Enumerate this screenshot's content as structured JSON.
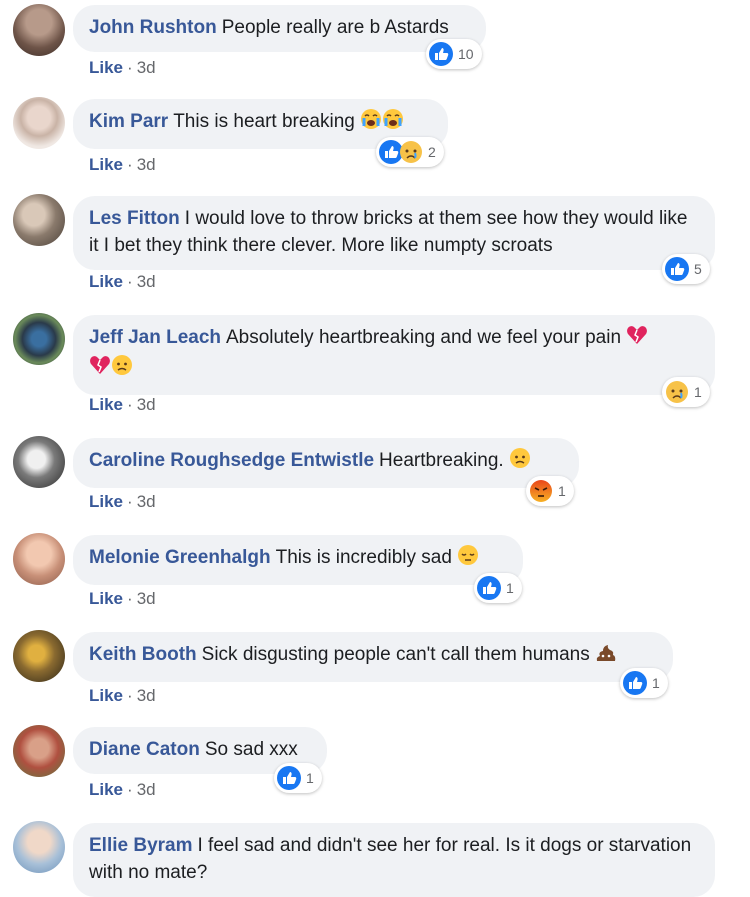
{
  "colors": {
    "author": "#385898",
    "bubble": "#f0f2f5",
    "meta": "#65676b",
    "like_blue": "#1877f2",
    "heart_red": "#e0245e"
  },
  "comments": [
    {
      "author": "John Rushton",
      "text": "People really are b Astards",
      "like": "Like",
      "time": "3d",
      "reactions": [
        "like-icon"
      ],
      "count": "10"
    },
    {
      "author": "Kim Parr",
      "text": "This is heart breaking",
      "emojis": [
        "crying-face-icon",
        "crying-face-icon"
      ],
      "like": "Like",
      "time": "3d",
      "reactions": [
        "like-icon",
        "sad-face-icon"
      ],
      "count": "2"
    },
    {
      "author": "Les Fitton",
      "text": "I would love to throw bricks at them see how they would like it I bet they think there clever. More like numpty scroats",
      "like": "Like",
      "time": "3d",
      "reactions": [
        "like-icon"
      ],
      "count": "5"
    },
    {
      "author": "Jeff Jan Leach",
      "text": "Absolutely heartbreaking and we feel your pain",
      "emojis": [
        "broken-heart-icon",
        "broken-heart-icon",
        "sad-face-icon"
      ],
      "like": "Like",
      "time": "3d",
      "reactions": [
        "sad-face-icon"
      ],
      "count": "1"
    },
    {
      "author": "Caroline Roughsedge Entwistle",
      "text": "Heartbreaking.",
      "emojis": [
        "sad-face-icon"
      ],
      "like": "Like",
      "time": "3d",
      "reactions": [
        "angry-face-icon"
      ],
      "count": "1"
    },
    {
      "author": "Melonie Greenhalgh",
      "text": "This is incredibly sad",
      "emojis": [
        "pensive-face-icon"
      ],
      "like": "Like",
      "time": "3d",
      "reactions": [
        "like-icon"
      ],
      "count": "1"
    },
    {
      "author": "Keith Booth",
      "text": "Sick disgusting people can't call them humans",
      "emojis": [
        "poop-icon"
      ],
      "like": "Like",
      "time": "3d",
      "reactions": [
        "like-icon"
      ],
      "count": "1"
    },
    {
      "author": "Diane Caton",
      "text": "So sad xxx",
      "like": "Like",
      "time": "3d",
      "reactions": [
        "like-icon"
      ],
      "count": "1"
    },
    {
      "author": "Ellie Byram",
      "text": "I feel sad and didn't see her for real. Is it dogs or starvation with no mate?"
    }
  ]
}
